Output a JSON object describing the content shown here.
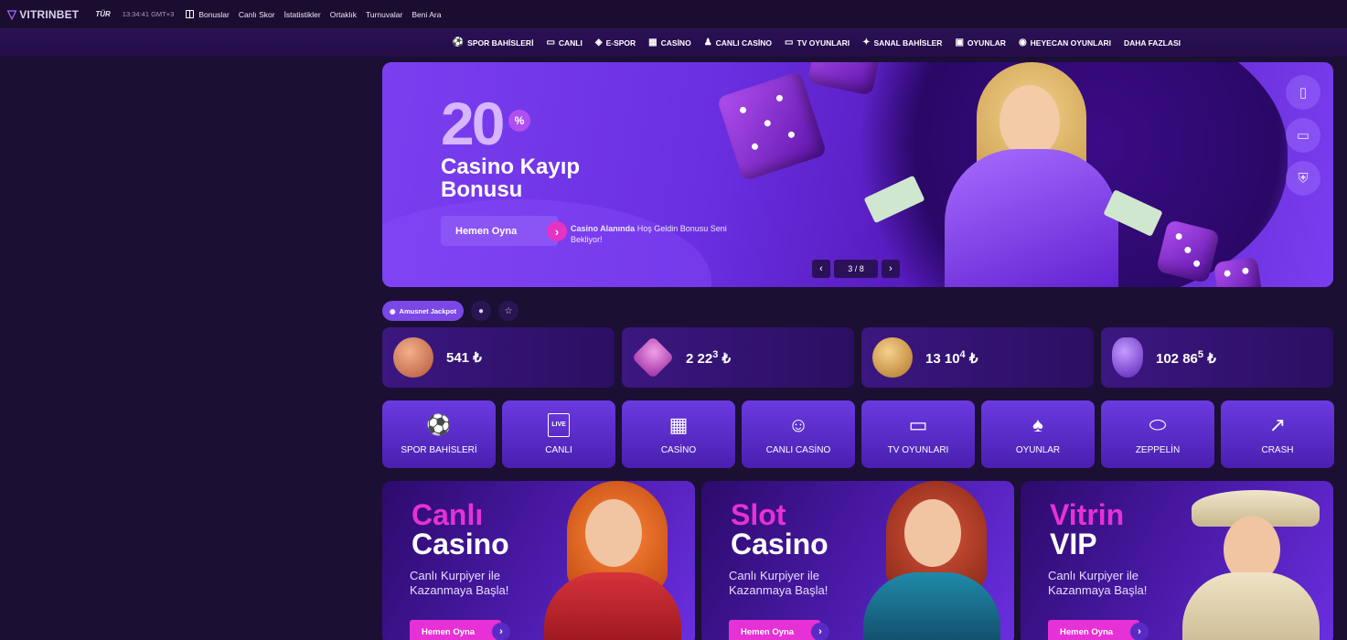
{
  "topbar": {
    "logo": "VITRINBET",
    "lang": "TÜR",
    "clock": "13:34:41",
    "timezone": "GMT+3",
    "links": [
      "Bonuslar",
      "Canlı Skor",
      "İstatistikler",
      "Ortaklık",
      "Turnuvalar",
      "Beni Ara"
    ]
  },
  "nav": {
    "items": [
      {
        "label": "SPOR BAHİSLERİ",
        "icon": "soccer-ball-icon"
      },
      {
        "label": "CANLI",
        "icon": "live-icon"
      },
      {
        "label": "E-SPOR",
        "icon": "gamepad-icon"
      },
      {
        "label": "CASİNO",
        "icon": "slot-icon"
      },
      {
        "label": "CANLI CASİNO",
        "icon": "dealer-icon"
      },
      {
        "label": "TV OYUNLARI",
        "icon": "tv-icon"
      },
      {
        "label": "SANAL BAHİSLER",
        "icon": "runner-icon"
      },
      {
        "label": "OYUNLAR",
        "icon": "dice-icon"
      },
      {
        "label": "HEYECAN OYUNLARI",
        "icon": "target-icon"
      },
      {
        "label": "DAHA FAZLASI",
        "icon": ""
      }
    ]
  },
  "hero": {
    "percent": "20",
    "percent_sign": "%",
    "title": "Casino Kayıp Bonusu",
    "button": "Hemen Oyna",
    "sub_bold": "Casino Alanında",
    "sub_rest": " Hoş Geldin Bonusu Seni Bekliyor!",
    "page": "3 / 8"
  },
  "jackpot_tabs": {
    "active": "Amusnet Jackpot"
  },
  "jackpots": [
    {
      "value": "541",
      "sup": "",
      "currency": "₺",
      "color": "#e08a6a"
    },
    {
      "value": "2 22",
      "sup": "3",
      "currency": "₺",
      "color": "#d86bd6"
    },
    {
      "value": "13 10",
      "sup": "4",
      "currency": "₺",
      "color": "#e0a14a"
    },
    {
      "value": "102 86",
      "sup": "5",
      "currency": "₺",
      "color": "#8a55e6"
    }
  ],
  "categories": [
    {
      "label": "SPOR BAHİSLERİ",
      "icon": "⚽"
    },
    {
      "label": "CANLI",
      "icon": "LIVE"
    },
    {
      "label": "CASİNO",
      "icon": "▦"
    },
    {
      "label": "CANLI CASİNO",
      "icon": "☺"
    },
    {
      "label": "TV OYUNLARI",
      "icon": "▭"
    },
    {
      "label": "OYUNLAR",
      "icon": "♠"
    },
    {
      "label": "ZEPPELİN",
      "icon": "⬭"
    },
    {
      "label": "CRASH",
      "icon": "↗"
    }
  ],
  "promos": [
    {
      "title1": "Canlı",
      "title2": "Casino",
      "sub": "Canlı Kurpiyer ile Kazanmaya Başla!",
      "button": "Hemen Oyna"
    },
    {
      "title1": "Slot",
      "title2": "Casino",
      "sub": "Canlı Kurpiyer ile Kazanmaya Başla!",
      "button": "Hemen Oyna"
    },
    {
      "title1": "Vitrin",
      "title2": "VIP",
      "sub": "Canlı Kurpiyer ile Kazanmaya Başla!",
      "button": "Hemen Oyna"
    }
  ]
}
